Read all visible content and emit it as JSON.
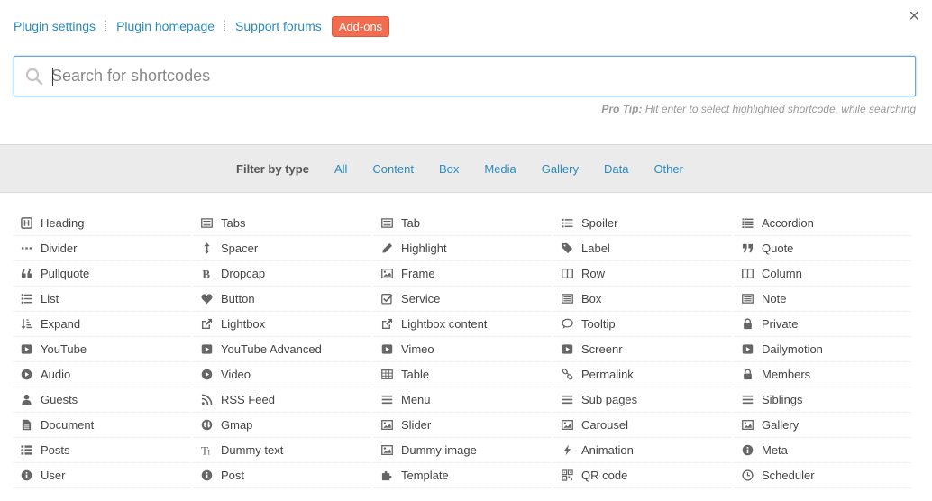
{
  "topnav": {
    "plugin_settings": "Plugin settings",
    "plugin_homepage": "Plugin homepage",
    "support_forums": "Support forums",
    "addons": "Add-ons"
  },
  "close_glyph": "×",
  "search": {
    "placeholder": "Search for shortcodes",
    "value": ""
  },
  "protip": {
    "label": "Pro Tip:",
    "text": "Hit enter to select highlighted shortcode, while searching"
  },
  "filter": {
    "label": "Filter by type",
    "types": [
      "All",
      "Content",
      "Box",
      "Media",
      "Gallery",
      "Data",
      "Other"
    ]
  },
  "shortcodes": [
    {
      "label": "Heading",
      "icon": "heading-icon"
    },
    {
      "label": "Tabs",
      "icon": "list-alt-icon"
    },
    {
      "label": "Tab",
      "icon": "list-alt-icon"
    },
    {
      "label": "Spoiler",
      "icon": "list-ul-icon"
    },
    {
      "label": "Accordion",
      "icon": "list-icon"
    },
    {
      "label": "Divider",
      "icon": "ellipsis-icon"
    },
    {
      "label": "Spacer",
      "icon": "arrows-v-icon"
    },
    {
      "label": "Highlight",
      "icon": "pencil-icon"
    },
    {
      "label": "Label",
      "icon": "tag-icon"
    },
    {
      "label": "Quote",
      "icon": "quote-right-icon"
    },
    {
      "label": "Pullquote",
      "icon": "quote-left-icon"
    },
    {
      "label": "Dropcap",
      "icon": "bold-icon"
    },
    {
      "label": "Frame",
      "icon": "picture-icon"
    },
    {
      "label": "Row",
      "icon": "columns-icon"
    },
    {
      "label": "Column",
      "icon": "columns-icon"
    },
    {
      "label": "List",
      "icon": "list-ol-icon"
    },
    {
      "label": "Button",
      "icon": "heart-icon"
    },
    {
      "label": "Service",
      "icon": "check-square-icon"
    },
    {
      "label": "Box",
      "icon": "list-alt-icon"
    },
    {
      "label": "Note",
      "icon": "list-alt-icon"
    },
    {
      "label": "Expand",
      "icon": "sort-amount-icon"
    },
    {
      "label": "Lightbox",
      "icon": "external-link-icon"
    },
    {
      "label": "Lightbox content",
      "icon": "external-link-icon"
    },
    {
      "label": "Tooltip",
      "icon": "comment-icon"
    },
    {
      "label": "Private",
      "icon": "lock-icon"
    },
    {
      "label": "YouTube",
      "icon": "play-square-icon"
    },
    {
      "label": "YouTube Advanced",
      "icon": "play-square-icon"
    },
    {
      "label": "Vimeo",
      "icon": "play-square-icon"
    },
    {
      "label": "Screenr",
      "icon": "play-square-icon"
    },
    {
      "label": "Dailymotion",
      "icon": "play-square-icon"
    },
    {
      "label": "Audio",
      "icon": "play-circle-icon"
    },
    {
      "label": "Video",
      "icon": "play-circle-icon"
    },
    {
      "label": "Table",
      "icon": "table-icon"
    },
    {
      "label": "Permalink",
      "icon": "link-icon"
    },
    {
      "label": "Members",
      "icon": "lock-icon"
    },
    {
      "label": "Guests",
      "icon": "user-icon"
    },
    {
      "label": "RSS Feed",
      "icon": "rss-icon"
    },
    {
      "label": "Menu",
      "icon": "bars-icon"
    },
    {
      "label": "Sub pages",
      "icon": "bars-icon"
    },
    {
      "label": "Siblings",
      "icon": "bars-icon"
    },
    {
      "label": "Document",
      "icon": "file-text-icon"
    },
    {
      "label": "Gmap",
      "icon": "globe-icon"
    },
    {
      "label": "Slider",
      "icon": "picture-icon"
    },
    {
      "label": "Carousel",
      "icon": "picture-icon"
    },
    {
      "label": "Gallery",
      "icon": "picture-icon"
    },
    {
      "label": "Posts",
      "icon": "th-list-icon"
    },
    {
      "label": "Dummy text",
      "icon": "text-height-icon"
    },
    {
      "label": "Dummy image",
      "icon": "picture-icon"
    },
    {
      "label": "Animation",
      "icon": "bolt-icon"
    },
    {
      "label": "Meta",
      "icon": "info-circle-icon"
    },
    {
      "label": "User",
      "icon": "info-circle-icon"
    },
    {
      "label": "Post",
      "icon": "info-circle-icon"
    },
    {
      "label": "Template",
      "icon": "puzzle-icon"
    },
    {
      "label": "QR code",
      "icon": "qrcode-icon"
    },
    {
      "label": "Scheduler",
      "icon": "clock-icon"
    }
  ]
}
